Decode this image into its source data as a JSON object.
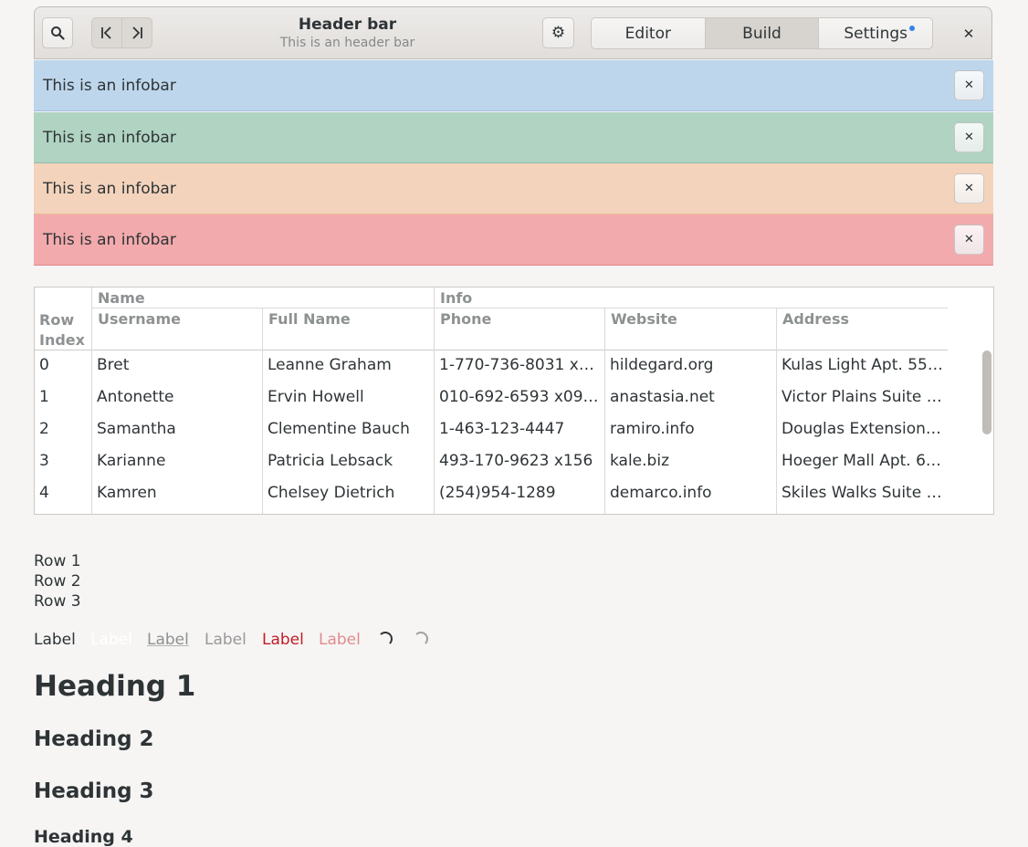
{
  "header": {
    "title": "Header bar",
    "subtitle": "This is an header bar",
    "switcher": [
      "Editor",
      "Build",
      "Settings"
    ],
    "active_tab": "Build"
  },
  "infobars": [
    {
      "text": "This is an infobar",
      "color": "#bed6ec",
      "border": "#9ebfe0"
    },
    {
      "text": "This is an infobar",
      "color": "#b0d3c2",
      "border": "#90bda7"
    },
    {
      "text": "This is an infobar",
      "color": "#f4d3bc",
      "border": "#e9b895"
    },
    {
      "text": "This is an infobar",
      "color": "#f2aaac",
      "border": "#e3878a"
    }
  ],
  "table": {
    "group_headers": [
      "Name",
      "Info"
    ],
    "column_headers": [
      "Row Index",
      "Username",
      "Full Name",
      "Phone",
      "Website",
      "Address"
    ],
    "rows": [
      [
        "0",
        "Bret",
        "Leanne Graham",
        "1-770-736-8031 x5…",
        "hildegard.org",
        "Kulas Light Apt. 55…"
      ],
      [
        "1",
        "Antonette",
        "Ervin Howell",
        "010-692-6593 x09…",
        "anastasia.net",
        "Victor Plains Suite …"
      ],
      [
        "2",
        "Samantha",
        "Clementine Bauch",
        "1-463-123-4447",
        "ramiro.info",
        "Douglas Extension …"
      ],
      [
        "3",
        "Karianne",
        "Patricia Lebsack",
        "493-170-9623 x156",
        "kale.biz",
        "Hoeger Mall Apt. 6…"
      ],
      [
        "4",
        "Kamren",
        "Chelsey Dietrich",
        "(254)954-1289",
        "demarco.info",
        "Skiles Walks Suite …"
      ]
    ]
  },
  "list_rows": [
    "Row 1",
    "Row 2",
    "Row 3"
  ],
  "labels": [
    "Label",
    "Label",
    "Label",
    "Label",
    "Label",
    "Label"
  ],
  "headings": [
    "Heading 1",
    "Heading 2",
    "Heading 3",
    "Heading 4"
  ]
}
